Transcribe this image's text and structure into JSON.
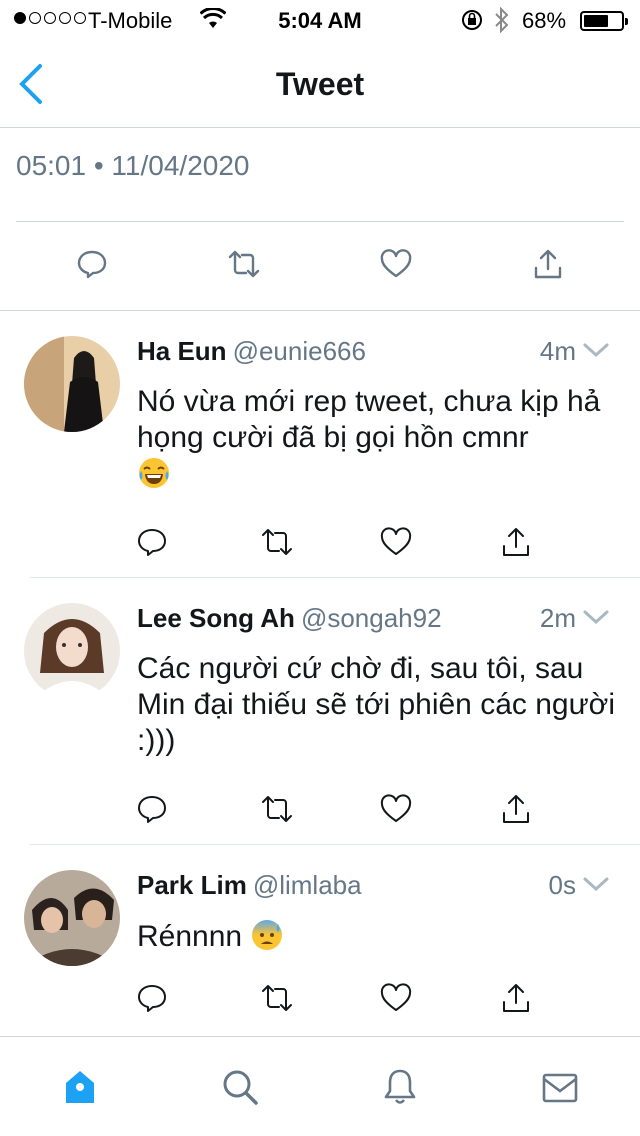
{
  "status_bar": {
    "carrier": "T-Mobile",
    "time": "5:04 AM",
    "battery_percent": "68%",
    "battery_level": 0.68
  },
  "nav": {
    "title": "Tweet"
  },
  "tweet": {
    "timestamp": "05:01 • 11/04/2020"
  },
  "colors": {
    "accent": "#1da1f2",
    "icon_gray": "#657786",
    "text": "#14171a"
  },
  "replies": [
    {
      "name": "Ha Eun",
      "handle": "@eunie666",
      "time": "4m",
      "text": "Nó vừa mới rep tweet, chưa kịp hả họng cười đã bị gọi hồn cmnr",
      "emoji": "tears-of-joy"
    },
    {
      "name": "Lee Song Ah",
      "handle": "@songah92",
      "time": "2m",
      "text": "Các người cứ chờ đi, sau tôi, sau Min đại thiếu sẽ tới phiên các người :)))",
      "emoji": ""
    },
    {
      "name": "Park Lim",
      "handle": "@limlaba",
      "time": "0s",
      "text": "Rénnnn",
      "emoji": "anxious-face-with-sweat"
    }
  ],
  "tab_bar": {
    "items": [
      "home-icon",
      "search-icon",
      "notifications-icon",
      "messages-icon"
    ],
    "active": "home-icon"
  }
}
